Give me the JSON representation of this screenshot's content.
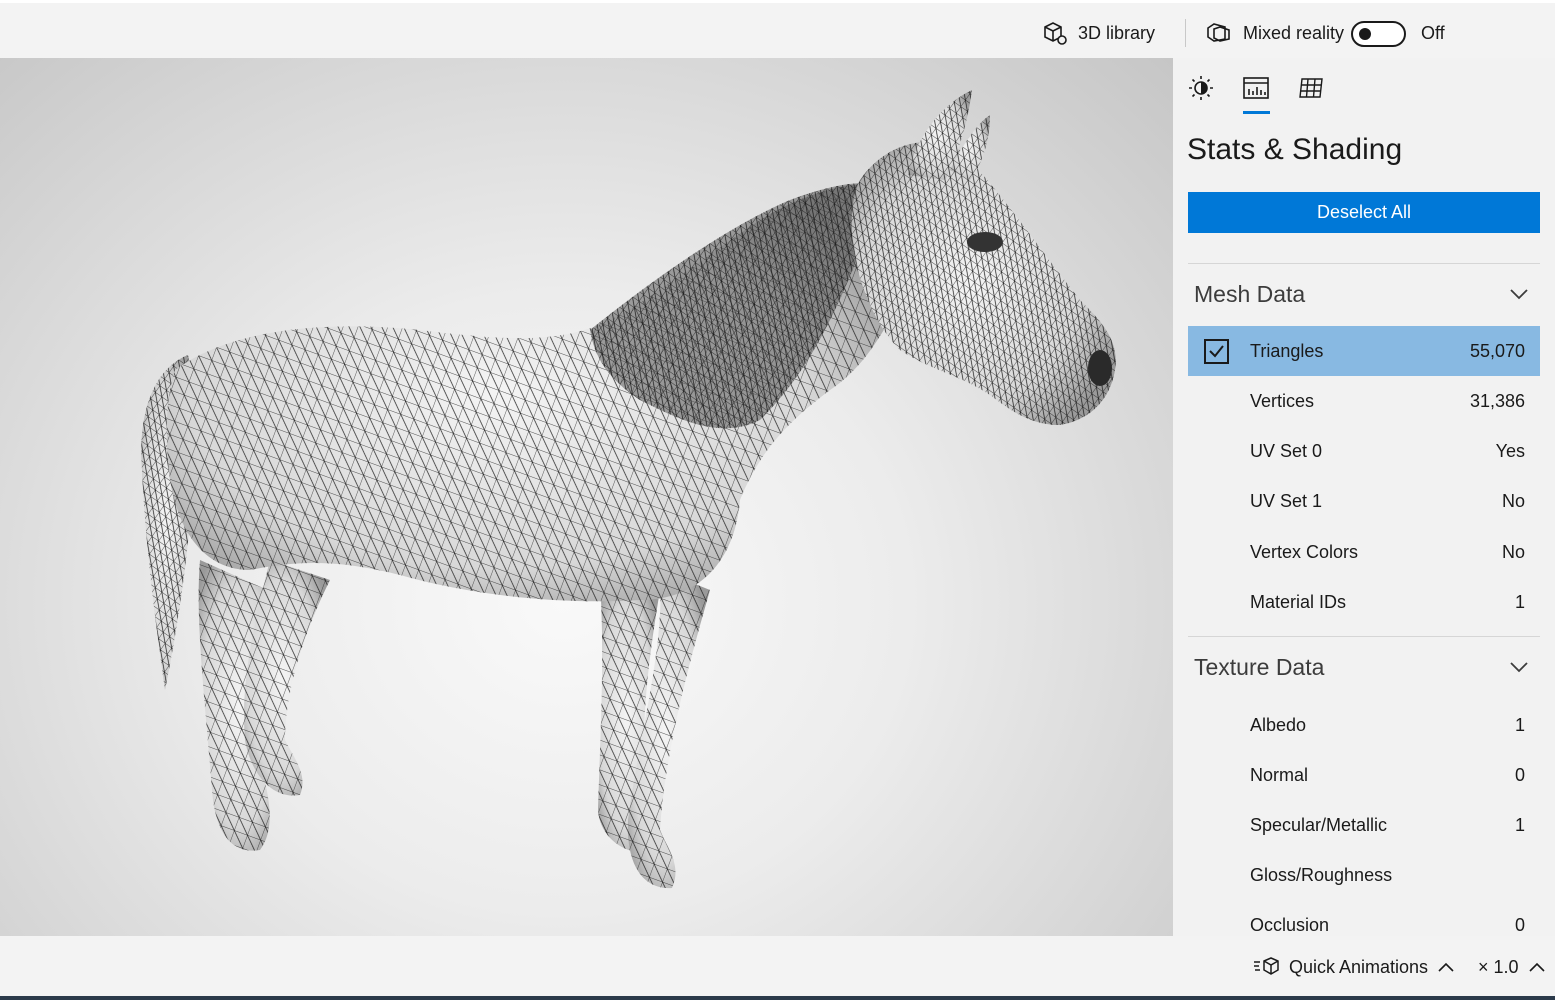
{
  "topbar": {
    "library_label": "3D library",
    "mixed_reality_label": "Mixed reality",
    "toggle_state": "Off",
    "toggle_on": false
  },
  "viewport": {
    "model": "horse",
    "render_mode": "wireframe"
  },
  "panel": {
    "tabs": [
      {
        "name": "lighting",
        "icon": "sun-icon"
      },
      {
        "name": "stats",
        "icon": "stats-icon",
        "active": true
      },
      {
        "name": "grid",
        "icon": "grid-icon"
      }
    ],
    "title": "Stats & Shading",
    "deselect_label": "Deselect All",
    "mesh": {
      "header": "Mesh Data",
      "rows": [
        {
          "name": "Triangles",
          "value": "55,070",
          "selected": true
        },
        {
          "name": "Vertices",
          "value": "31,386"
        },
        {
          "name": "UV Set 0",
          "value": "Yes"
        },
        {
          "name": "UV Set 1",
          "value": "No"
        },
        {
          "name": "Vertex Colors",
          "value": "No"
        },
        {
          "name": "Material IDs",
          "value": "1"
        }
      ]
    },
    "texture": {
      "header": "Texture Data",
      "rows": [
        {
          "name": "Albedo",
          "value": "1"
        },
        {
          "name": "Normal",
          "value": "0"
        },
        {
          "name": "Specular/Metallic",
          "value": "1"
        },
        {
          "name": "Gloss/Roughness",
          "value": ""
        },
        {
          "name": "Occlusion",
          "value": "0"
        }
      ]
    }
  },
  "bottombar": {
    "quick_animations_label": "Quick Animations",
    "speed_label": "× 1.0"
  },
  "colors": {
    "accent": "#0078d7",
    "selected_row": "#88b9e2"
  }
}
